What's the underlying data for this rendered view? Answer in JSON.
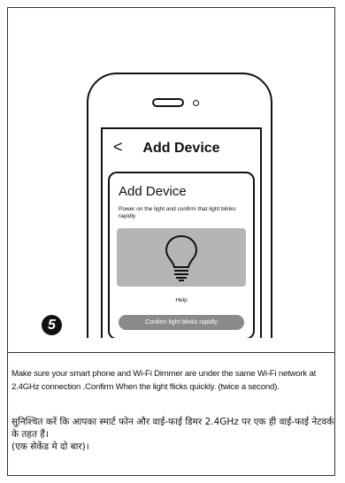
{
  "step": {
    "number": "5"
  },
  "phone": {
    "header": {
      "back_glyph": "<",
      "title": "Add Device"
    },
    "card": {
      "title": "Add Device",
      "description": "Power on the light and confirm that light blinks rapidly",
      "illustration_icon": "light-bulb-icon",
      "help_label": "Help",
      "confirm_label": "Confirm light blinks rapidly"
    }
  },
  "instructions": {
    "english": "Make sure your smart phone and Wi-Fi Dimmer are under the same Wi-Fi network at 2.4GHz connection .Confirm When the light flicks quickly. (twice a second).",
    "hindi_line1": "सुनिश्चित करें कि आपका स्मार्ट फोन और वाई-फाई डिमर 2.4GHz पर एक ही वाई-फाई नेटवर्क के तहत हैं।",
    "hindi_line2": "(एक सेकेंड मे दो बार)।"
  },
  "colors": {
    "card_gray": "#b5b5b5",
    "button_gray": "#8a8a8a",
    "ink": "#111111"
  }
}
